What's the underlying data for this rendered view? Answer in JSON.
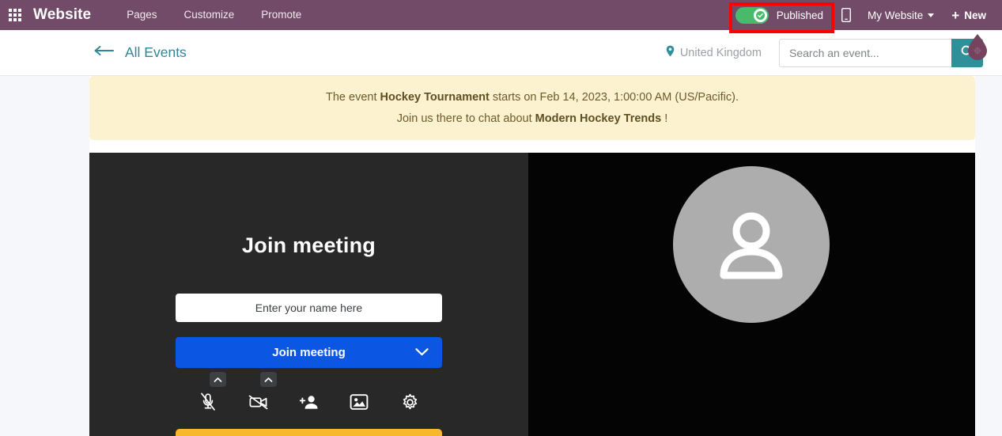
{
  "navbar": {
    "apps_icon": "apps-grid-icon",
    "brand": "Website",
    "links": [
      {
        "label": "Pages"
      },
      {
        "label": "Customize"
      },
      {
        "label": "Promote"
      }
    ],
    "publish": {
      "label": "Published",
      "state": "on",
      "toggle_color": "#49ba6c",
      "highlight_color": "#ff0000",
      "check_icon": "check-circle-icon"
    },
    "mobile_preview_icon": "mobile-phone-icon",
    "website_selector": {
      "label": "My Website",
      "caret_icon": "caret-down-icon"
    },
    "new_button": {
      "label": "New",
      "plus_icon": "plus-icon"
    },
    "background_color": "#714B67"
  },
  "subheader": {
    "back_icon": "arrow-left-icon",
    "back_label": "All Events",
    "accent_color": "#31859a",
    "location": {
      "pin_icon": "map-pin-icon",
      "label": "United Kingdom"
    },
    "search": {
      "placeholder": "Search an event...",
      "value": "",
      "button_icon": "search-icon",
      "button_color": "#30909a"
    },
    "droplet_icon": "droplet-handle-icon",
    "droplet_color": "#76435f"
  },
  "alert": {
    "background_color": "#fcf2cf",
    "line1_pre": "The event ",
    "line1_event": "Hockey Tournament",
    "line1_post": " starts on Feb 14, 2023, 1:00:00 AM (US/Pacific).",
    "line2_pre": "Join us there to chat about ",
    "line2_topic": "Modern Hockey Trends",
    "line2_post": " !"
  },
  "meeting": {
    "title": "Join meeting",
    "name_input": {
      "placeholder": "Enter your name here",
      "value": ""
    },
    "join_button": {
      "label": "Join meeting",
      "color": "#0b57e3",
      "chevron_icon": "chevron-down-icon"
    },
    "controls": [
      {
        "name": "microphone-muted-icon",
        "label": "Microphone (muted)",
        "has_popup": true,
        "popup_icon": "chevron-up-icon"
      },
      {
        "name": "camera-muted-icon",
        "label": "Camera (off)",
        "has_popup": true,
        "popup_icon": "chevron-up-icon"
      },
      {
        "name": "add-person-icon",
        "label": "Invite people",
        "has_popup": false
      },
      {
        "name": "background-image-icon",
        "label": "Change background",
        "has_popup": false
      },
      {
        "name": "settings-gear-icon",
        "label": "Settings",
        "has_popup": false
      }
    ],
    "bottom_bar_color": "#f7b82b",
    "avatar": {
      "icon": "person-avatar-icon",
      "circle_color": "#adadad"
    },
    "left_panel_color": "#282828",
    "right_panel_color": "#040404"
  }
}
